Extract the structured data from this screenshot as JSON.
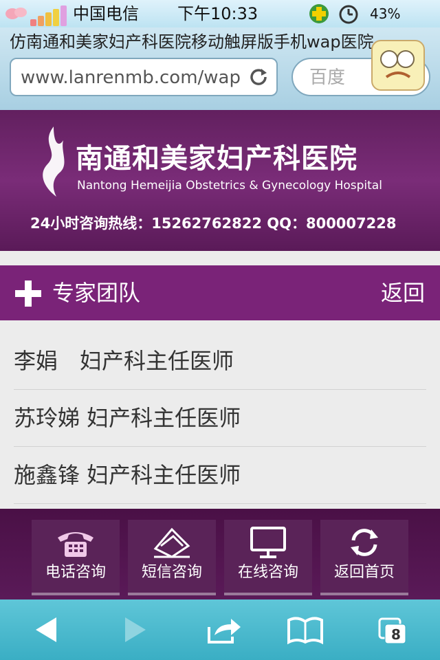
{
  "status_bar": {
    "carrier": "中国电信",
    "time": "下午10:33",
    "battery": "43%"
  },
  "browser": {
    "page_title": "仿南通和美家妇产科医院移动触屏版手机wap医院...",
    "url": "www.lanrenmb.com/wap",
    "search_placeholder": "百度"
  },
  "header": {
    "hospital_name_cn": "南通和美家妇产科医院",
    "hospital_name_en": "Nantong Hemeijia Obstetrics & Gynecology Hospital",
    "hotline": "24小时咨询热线：15262762822 QQ：800007228"
  },
  "section": {
    "title": "专家团队",
    "back_label": "返回"
  },
  "doctors": [
    {
      "text": "李娟　妇产科主任医师"
    },
    {
      "text": "苏玲娣 妇产科主任医师"
    },
    {
      "text": "施鑫锋 妇产科主任医师"
    }
  ],
  "footer": {
    "buttons": [
      {
        "label": "电话咨询",
        "icon": "phone-icon"
      },
      {
        "label": "短信咨询",
        "icon": "envelope-icon"
      },
      {
        "label": "在线咨询",
        "icon": "monitor-icon"
      },
      {
        "label": "返回首页",
        "icon": "refresh-icon"
      }
    ]
  },
  "toolbar": {
    "tabs_count": "8"
  },
  "colors": {
    "brand_purple": "#7a2378",
    "footer_purple": "#5a1a58",
    "toolbar_cyan": "#3aaec4"
  }
}
